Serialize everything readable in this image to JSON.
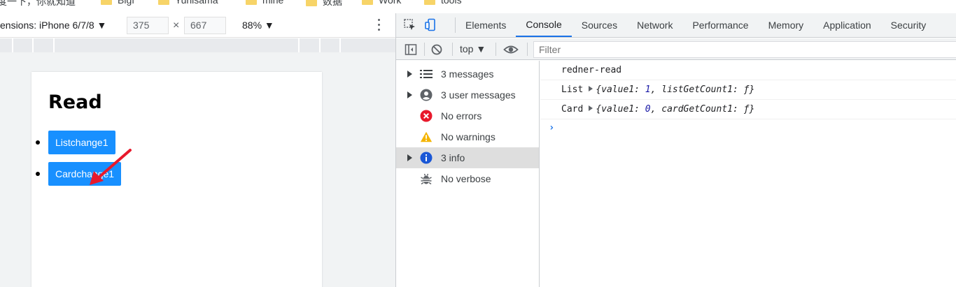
{
  "bookmarks": [
    {
      "label": "度一下，你就知道"
    },
    {
      "label": "Bigf"
    },
    {
      "label": "Yunisama"
    },
    {
      "label": "mine"
    },
    {
      "label": "数据"
    },
    {
      "label": "Work"
    },
    {
      "label": "tools"
    }
  ],
  "device_toolbar": {
    "dimensions_label": "ensions: iPhone 6/7/8 ▼",
    "width_value": "375",
    "times": "×",
    "height_value": "667",
    "zoom": "88% ▼"
  },
  "page": {
    "heading": "Read",
    "buttons": [
      {
        "label": "Listchange1"
      },
      {
        "label": "Cardchange1"
      }
    ],
    "annotation_color": "#e8192c"
  },
  "devtools": {
    "tabs": [
      {
        "label": "Elements"
      },
      {
        "label": "Console"
      },
      {
        "label": "Sources"
      },
      {
        "label": "Network"
      },
      {
        "label": "Performance"
      },
      {
        "label": "Memory"
      },
      {
        "label": "Application"
      },
      {
        "label": "Security"
      }
    ],
    "active_tab": "Console",
    "context": "top ▼",
    "filter_placeholder": "Filter",
    "sidebar": [
      {
        "label": "3 messages",
        "icon": "list-icon",
        "expandable": true
      },
      {
        "label": "3 user messages",
        "icon": "user-icon",
        "expandable": true
      },
      {
        "label": "No errors",
        "icon": "error-icon",
        "expandable": false
      },
      {
        "label": "No warnings",
        "icon": "warning-icon",
        "expandable": false
      },
      {
        "label": "3 info",
        "icon": "info-icon",
        "expandable": true,
        "selected": true
      },
      {
        "label": "No verbose",
        "icon": "bug-icon",
        "expandable": false
      }
    ],
    "log": {
      "line1": "redner-read",
      "line2": {
        "prefix": "List",
        "open": "{value1: ",
        "value": "1",
        "rest": ", listGetCount1: ƒ}"
      },
      "line3": {
        "prefix": "Card",
        "open": "{value1: ",
        "value": "0",
        "rest": ", cardGetCount1: ƒ}"
      },
      "prompt": "›"
    }
  }
}
